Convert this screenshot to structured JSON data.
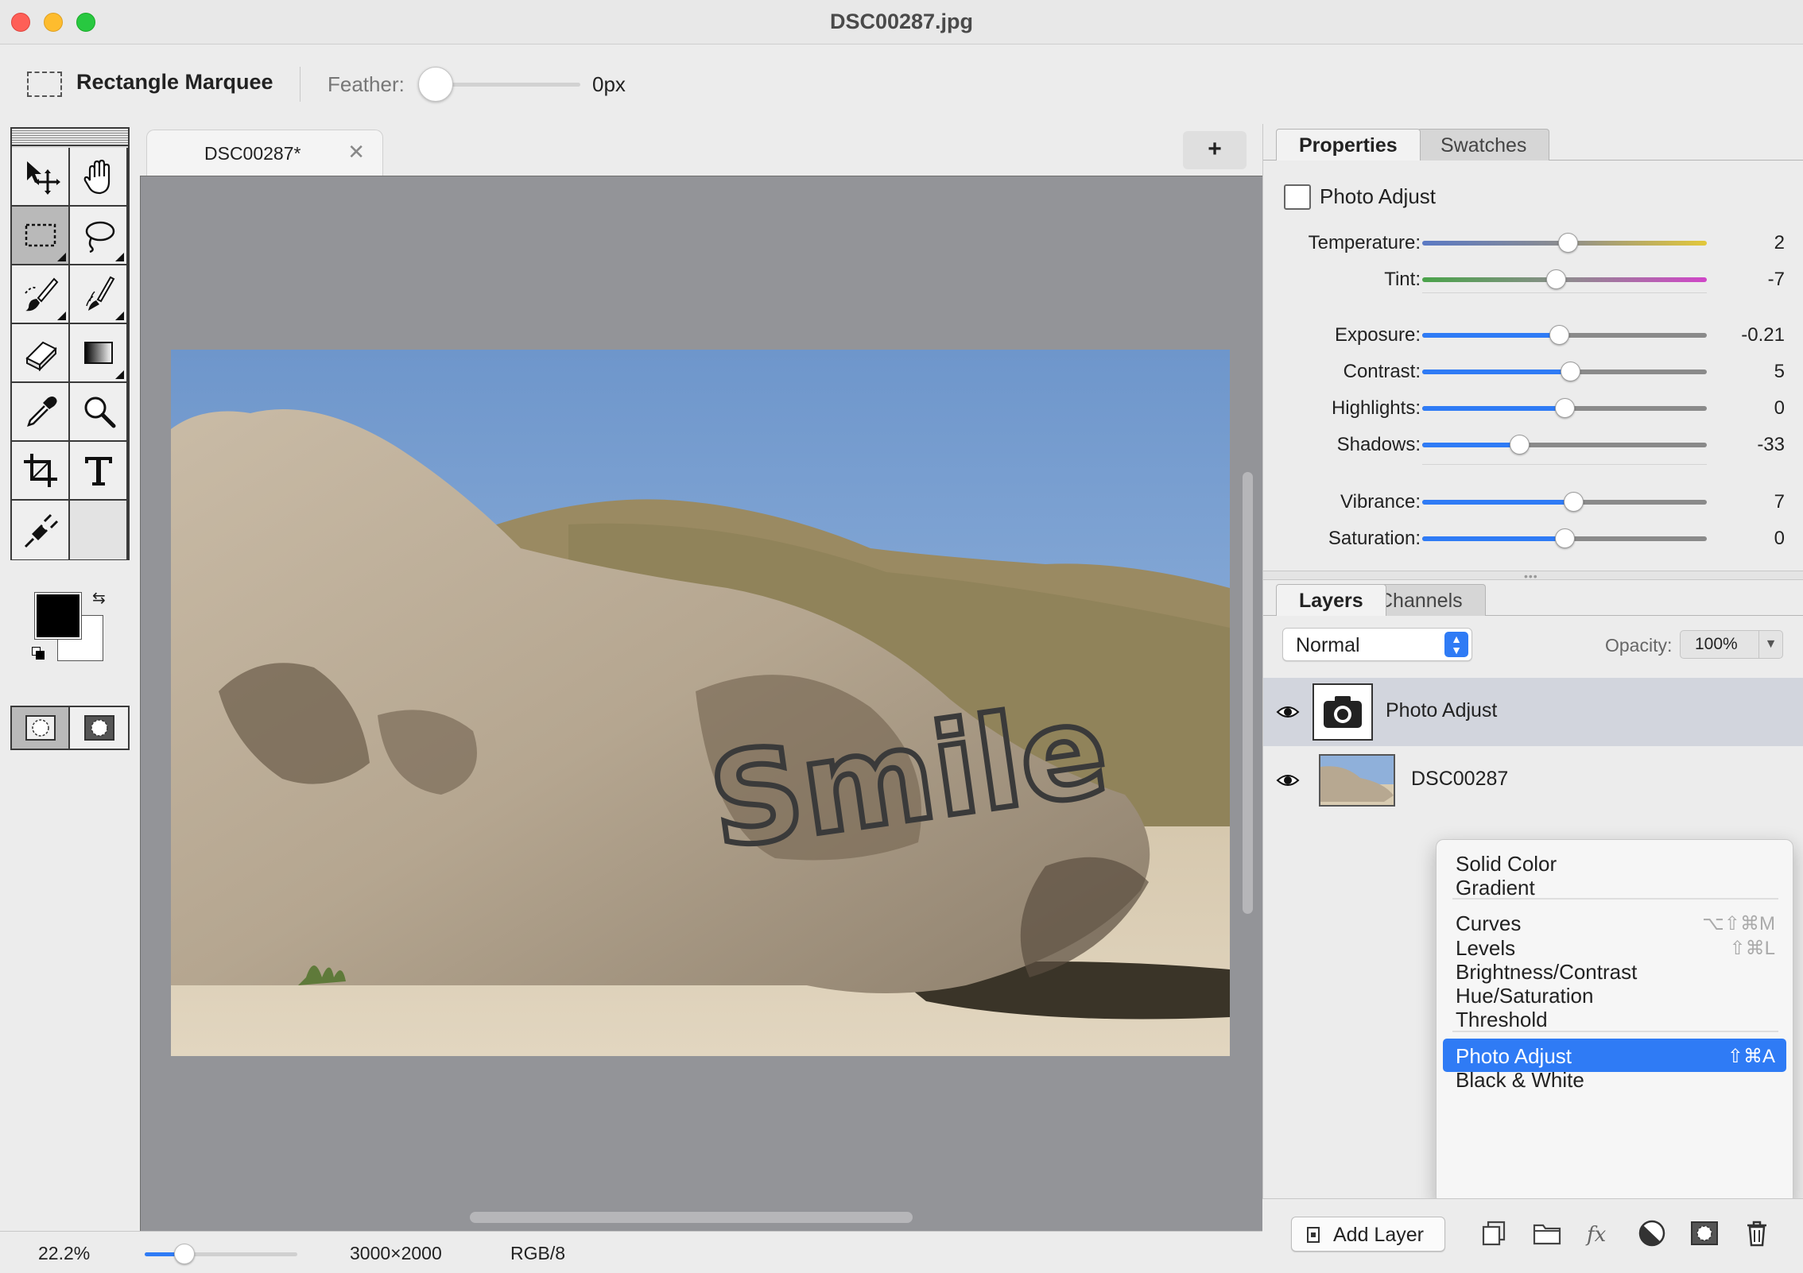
{
  "window": {
    "title": "DSC00287.jpg"
  },
  "options_bar": {
    "tool_name": "Rectangle Marquee",
    "feather_label": "Feather:",
    "feather_value": "0px"
  },
  "document": {
    "tab_label": "DSC00287*",
    "close_glyph": "✕",
    "new_tab_glyph": "+"
  },
  "toolbox": {
    "tools": [
      "move-icon",
      "hand-icon",
      "rectangle-marquee-icon",
      "lasso-icon",
      "brush-icon",
      "smudge-icon",
      "eraser-icon",
      "gradient-icon",
      "eyedropper-icon",
      "zoom-icon",
      "crop-icon",
      "text-icon",
      "plug-icon"
    ],
    "active_tool": "rectangle-marquee-icon",
    "foreground_color": "#000000",
    "background_color": "#ffffff"
  },
  "properties_panel": {
    "tabs": [
      "Properties",
      "Swatches"
    ],
    "active_tab": "Properties",
    "title": "Photo Adjust",
    "adjustments": [
      {
        "label": "Temperature:",
        "value": "2",
        "position": 0.51,
        "style": "temperature"
      },
      {
        "label": "Tint:",
        "value": "-7",
        "position": 0.47,
        "style": "tint"
      },
      {
        "label": "Exposure:",
        "value": "-0.21",
        "position": 0.48,
        "style": "blue"
      },
      {
        "label": "Contrast:",
        "value": "5",
        "position": 0.52,
        "style": "blue"
      },
      {
        "label": "Highlights:",
        "value": "0",
        "position": 0.5,
        "style": "blue"
      },
      {
        "label": "Shadows:",
        "value": "-33",
        "position": 0.34,
        "style": "blue"
      },
      {
        "label": "Vibrance:",
        "value": "7",
        "position": 0.53,
        "style": "blue"
      },
      {
        "label": "Saturation:",
        "value": "0",
        "position": 0.5,
        "style": "blue"
      }
    ]
  },
  "layers_panel": {
    "tabs": [
      "Layers",
      "Channels"
    ],
    "active_tab": "Layers",
    "blend_mode": "Normal",
    "opacity_label": "Opacity:",
    "opacity_value": "100%",
    "layers": [
      {
        "name": "Photo Adjust",
        "visible": true,
        "selected": true,
        "kind": "adjustment"
      },
      {
        "name": "DSC00287",
        "visible": true,
        "selected": false,
        "kind": "image"
      }
    ],
    "add_layer_label": "Add Layer"
  },
  "add_layer_menu": {
    "items": [
      {
        "label": "Solid Color",
        "shortcut": ""
      },
      {
        "label": "Gradient",
        "shortcut": ""
      },
      {
        "label": "Curves",
        "shortcut": "⌥⇧⌘M"
      },
      {
        "label": "Levels",
        "shortcut": "⇧⌘L"
      },
      {
        "label": "Brightness/Contrast",
        "shortcut": ""
      },
      {
        "label": "Hue/Saturation",
        "shortcut": ""
      },
      {
        "label": "Threshold",
        "shortcut": ""
      },
      {
        "label": "Photo Adjust",
        "shortcut": "⇧⌘A"
      },
      {
        "label": "Black & White",
        "shortcut": ""
      }
    ],
    "highlighted": "Photo Adjust"
  },
  "status_bar": {
    "zoom": "22.2%",
    "zoom_level": 0.26,
    "dimensions": "3000×2000",
    "color_mode": "RGB/8"
  },
  "colors": {
    "accent": "#2f7bf5",
    "canvas_bg": "#939498"
  }
}
